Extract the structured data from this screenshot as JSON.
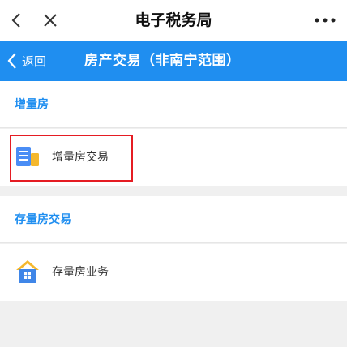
{
  "topbar": {
    "title": "电子税务局",
    "back_icon": "chevron-left-icon",
    "close_icon": "close-icon",
    "more_icon": "more-dots-icon"
  },
  "appbar": {
    "back_label": "返回",
    "title": "房产交易（非南宁范围）",
    "color": "#1f8ef0"
  },
  "sections": [
    {
      "title": "增量房",
      "items": [
        {
          "label": "增量房交易",
          "icon": "buildings-icon"
        }
      ]
    },
    {
      "title": "存量房交易",
      "items": [
        {
          "label": "存量房业务",
          "icon": "house-icon"
        }
      ]
    }
  ]
}
